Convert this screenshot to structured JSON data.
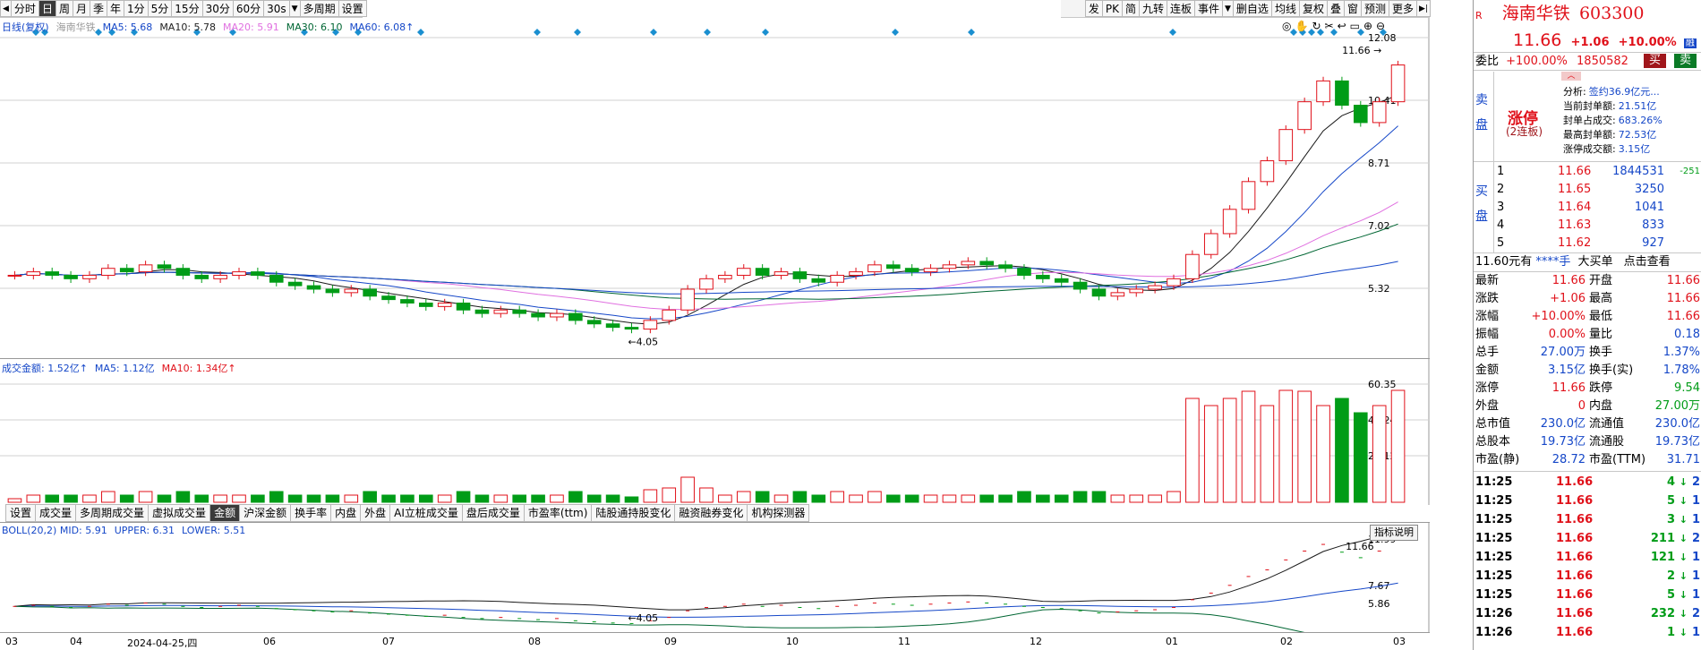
{
  "toolbar_left": [
    {
      "label": "◀",
      "kind": "arrow"
    },
    {
      "label": "分时"
    },
    {
      "label": "日",
      "active": true
    },
    {
      "label": "周"
    },
    {
      "label": "月"
    },
    {
      "label": "季"
    },
    {
      "label": "年"
    },
    {
      "label": "1分"
    },
    {
      "label": "5分"
    },
    {
      "label": "15分"
    },
    {
      "label": "30分"
    },
    {
      "label": "60分"
    },
    {
      "label": "30s"
    },
    {
      "label": "▼",
      "kind": "arrow"
    },
    {
      "label": "多周期"
    },
    {
      "label": "设置"
    }
  ],
  "toolbar_right": [
    {
      "label": "发"
    },
    {
      "label": "PK"
    },
    {
      "label": "简"
    },
    {
      "label": "九转"
    },
    {
      "label": "连板"
    },
    {
      "label": "事件"
    },
    {
      "label": "▼",
      "kind": "arrow"
    },
    {
      "label": "删自选"
    },
    {
      "label": "均线"
    },
    {
      "label": "复权"
    },
    {
      "label": "叠"
    },
    {
      "label": "窗"
    },
    {
      "label": "预测"
    },
    {
      "label": "更多"
    },
    {
      "label": "▶|",
      "kind": "arrow"
    }
  ],
  "main_legend": [
    {
      "text": "日线(复权)",
      "color": "#1547c8"
    },
    {
      "text": "海南华铁",
      "color": "#9a9a9a"
    },
    {
      "text": "MA5: 5.68",
      "color": "#1547c8"
    },
    {
      "text": "MA10: 5.78",
      "color": "#222222"
    },
    {
      "text": "MA20: 5.91",
      "color": "#e070e0"
    },
    {
      "text": "MA30: 6.10",
      "color": "#006633"
    },
    {
      "text": "MA60: 6.08↑",
      "color": "#1547c8"
    }
  ],
  "main_axis": [
    "12.08",
    "10.41",
    "8.71",
    "7.02",
    "5.32"
  ],
  "main_annotations": {
    "high": "11.66",
    "low": "4.05"
  },
  "vol_legend": [
    {
      "text": "成交金额: 1.52亿↑",
      "color": "#1547c8"
    },
    {
      "text": "MA5: 1.12亿",
      "color": "#1547c8"
    },
    {
      "text": "MA10: 1.34亿↑",
      "color": "#e0111a"
    }
  ],
  "vol_axis": [
    "60.35",
    "40.24",
    "20.12"
  ],
  "boll_legend": [
    {
      "text": "BOLL(20,2) MID: 5.91",
      "color": "#1547c8"
    },
    {
      "text": "UPPER: 6.31",
      "color": "#1547c8"
    },
    {
      "text": "LOWER: 5.51",
      "color": "#1547c8"
    }
  ],
  "boll_axis": [
    "11.99",
    "7.67",
    "5.86"
  ],
  "boll_annotations": {
    "high": "11.66",
    "low": "4.05"
  },
  "indicator_tabs": [
    {
      "label": "设置"
    },
    {
      "label": "成交量"
    },
    {
      "label": "多周期成交量"
    },
    {
      "label": "虚拟成交量"
    },
    {
      "label": "金额",
      "active": true
    },
    {
      "label": "沪深金额"
    },
    {
      "label": "换手率"
    },
    {
      "label": "内盘"
    },
    {
      "label": "外盘"
    },
    {
      "label": "AI立桩成交量"
    },
    {
      "label": "盘后成交量"
    },
    {
      "label": "市盈率(ttm)"
    },
    {
      "label": "陆股通持股变化"
    },
    {
      "label": "融资融券变化"
    },
    {
      "label": "机构探测器"
    }
  ],
  "help_label": "指标说明",
  "date_labels": [
    {
      "text": "03"
    },
    {
      "text": "04"
    },
    {
      "text": "2024-04-25,四"
    },
    {
      "text": "06"
    },
    {
      "text": "07"
    },
    {
      "text": "08"
    },
    {
      "text": "09"
    },
    {
      "text": "10"
    },
    {
      "text": "11"
    },
    {
      "text": "12"
    },
    {
      "text": "01"
    },
    {
      "text": "02"
    },
    {
      "text": "03"
    }
  ],
  "side": {
    "name": "海南华铁",
    "code": "603300",
    "price": "11.66",
    "change": "+1.06",
    "pct": "+10.00%",
    "badge": "融",
    "weibi_label": "委比",
    "weibi": "+100.00%",
    "weicha": "1850582",
    "buy_btn": "买",
    "sell_btn": "卖",
    "sell_label": "卖盘",
    "limit_title": "涨停",
    "limit_sub": "(2连板)",
    "analysis": [
      {
        "k": "分析:",
        "v": "签约36.9亿元..."
      },
      {
        "k": "当前封单额:",
        "v": "21.51亿"
      },
      {
        "k": "封单占成交:",
        "v": "683.26%"
      },
      {
        "k": "最高封单额:",
        "v": "72.53亿"
      },
      {
        "k": "涨停成交额:",
        "v": "3.15亿"
      }
    ],
    "buy_label": "买盘",
    "bids": [
      {
        "lvl": "1",
        "p": "11.66",
        "v": "1844531",
        "d": "-251"
      },
      {
        "lvl": "2",
        "p": "11.65",
        "v": "3250",
        "d": ""
      },
      {
        "lvl": "3",
        "p": "11.64",
        "v": "1041",
        "d": ""
      },
      {
        "lvl": "4",
        "p": "11.63",
        "v": "833",
        "d": ""
      },
      {
        "lvl": "5",
        "p": "11.62",
        "v": "927",
        "d": ""
      }
    ],
    "bigbar": {
      "a": "11.60元有",
      "b": "****手",
      "c": "大买单",
      "d": "点击查看"
    },
    "stats": [
      {
        "k1": "最新",
        "v1": "11.66",
        "k2": "开盘",
        "v2": "11.66"
      },
      {
        "k1": "涨跌",
        "v1": "+1.06",
        "k2": "最高",
        "v2": "11.66"
      },
      {
        "k1": "涨幅",
        "v1": "+10.00%",
        "k2": "最低",
        "v2": "11.66"
      },
      {
        "k1": "振幅",
        "v1": "0.00%",
        "k2": "量比",
        "v2": "0.18"
      },
      {
        "k1": "总手",
        "v1": "27.00万",
        "k2": "换手",
        "v2": "1.37%"
      },
      {
        "k1": "金额",
        "v1": "3.15亿",
        "k2": "换手(实)",
        "v2": "1.78%"
      },
      {
        "k1": "涨停",
        "v1": "11.66",
        "k2": "跌停",
        "v2": "9.54"
      },
      {
        "k1": "外盘",
        "v1": "0",
        "k2": "内盘",
        "v2": "27.00万"
      },
      {
        "k1": "总市值",
        "v1": "230.0亿",
        "k2": "流通值",
        "v2": "230.0亿"
      },
      {
        "k1": "总股本",
        "v1": "19.73亿",
        "k2": "流通股",
        "v2": "19.73亿"
      },
      {
        "k1": "市盈(静)",
        "v1": "28.72",
        "k2": "市盈(TTM)",
        "v2": "31.71"
      }
    ],
    "ticks": [
      {
        "t": "11:25",
        "p": "11.66",
        "v": "4",
        "n": "2"
      },
      {
        "t": "11:25",
        "p": "11.66",
        "v": "5",
        "n": "1"
      },
      {
        "t": "11:25",
        "p": "11.66",
        "v": "3",
        "n": "1"
      },
      {
        "t": "11:25",
        "p": "11.66",
        "v": "211",
        "n": "2"
      },
      {
        "t": "11:25",
        "p": "11.66",
        "v": "121",
        "n": "1"
      },
      {
        "t": "11:25",
        "p": "11.66",
        "v": "2",
        "n": "1"
      },
      {
        "t": "11:25",
        "p": "11.66",
        "v": "5",
        "n": "1"
      },
      {
        "t": "11:26",
        "p": "11.66",
        "v": "232",
        "n": "2"
      },
      {
        "t": "11:26",
        "p": "11.66",
        "v": "1",
        "n": "1"
      }
    ]
  },
  "colors": {
    "up": "#e0111a",
    "down": "#009c17",
    "grid": "#d0d0d0",
    "blue": "#1547c8"
  },
  "chart_data": {
    "type": "candlestick",
    "title": "",
    "series_main": "price",
    "price_range": [
      4.05,
      11.66
    ],
    "prices": [
      5.6,
      5.7,
      5.6,
      5.5,
      5.6,
      5.8,
      5.7,
      5.9,
      5.8,
      5.6,
      5.5,
      5.6,
      5.7,
      5.6,
      5.4,
      5.3,
      5.2,
      5.1,
      5.2,
      5.0,
      4.9,
      4.8,
      4.7,
      4.8,
      4.6,
      4.5,
      4.6,
      4.5,
      4.4,
      4.5,
      4.3,
      4.2,
      4.1,
      4.05,
      4.3,
      4.6,
      5.2,
      5.5,
      5.6,
      5.8,
      5.6,
      5.7,
      5.5,
      5.4,
      5.6,
      5.7,
      5.9,
      5.8,
      5.7,
      5.8,
      5.9,
      6.0,
      5.9,
      5.8,
      5.6,
      5.5,
      5.4,
      5.2,
      5.0,
      5.1,
      5.2,
      5.3,
      5.5,
      6.2,
      6.8,
      7.5,
      8.3,
      8.9,
      9.8,
      10.6,
      11.2,
      10.5,
      10.0,
      10.6,
      11.66
    ]
  }
}
